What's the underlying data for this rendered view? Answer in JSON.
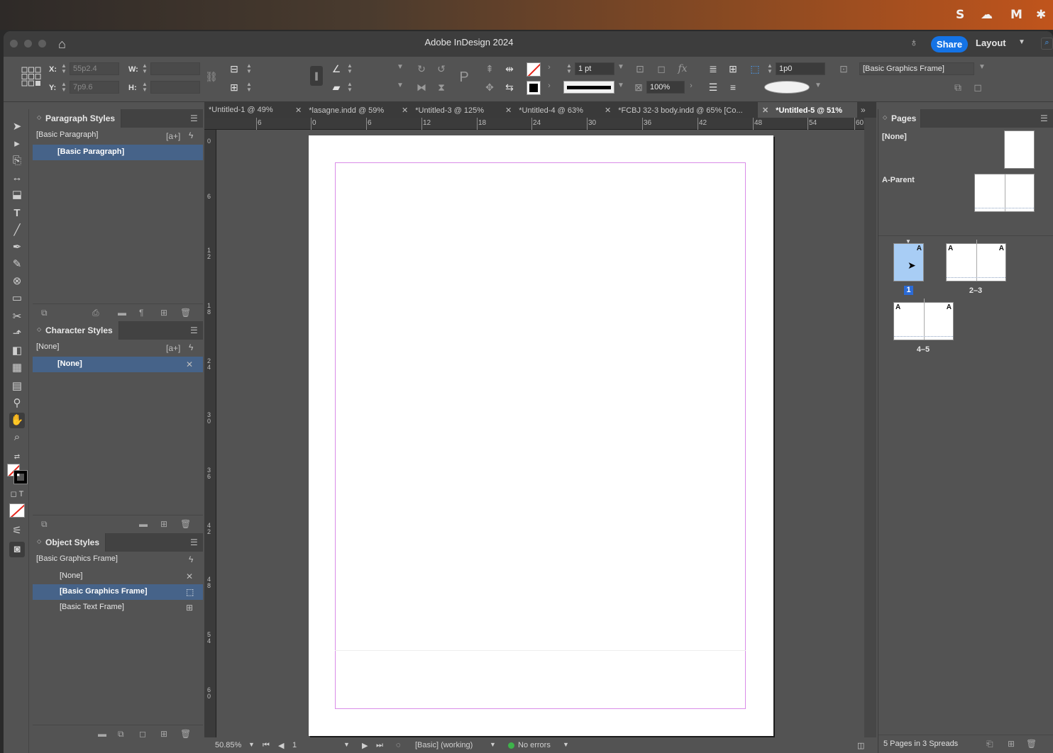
{
  "menubar": {
    "tray": [
      "S",
      "☁",
      "M",
      "✱"
    ]
  },
  "window": {
    "title": "Adobe InDesign 2024",
    "share_label": "Share",
    "workspace_label": "Layout"
  },
  "control_panel": {
    "x_label": "X:",
    "x_value": "55p2.4",
    "y_label": "Y:",
    "y_value": "7p9.6",
    "w_label": "W:",
    "h_label": "H:",
    "stroke_weight": "1 pt",
    "opacity": "100%",
    "gap": "1p0",
    "object_style": "[Basic Graphics Frame]"
  },
  "paragraph_styles": {
    "title": "Paragraph Styles",
    "current": "[Basic Paragraph]",
    "items": [
      "[Basic Paragraph]"
    ]
  },
  "character_styles": {
    "title": "Character Styles",
    "current": "[None]",
    "items": [
      "[None]"
    ]
  },
  "object_styles": {
    "title": "Object Styles",
    "current": "[Basic Graphics Frame]",
    "items": [
      "[None]",
      "[Basic Graphics Frame]",
      "[Basic Text Frame]"
    ]
  },
  "doc_tabs": [
    "*Untitled-1 @ 49%",
    "*lasagne.indd @ 59%",
    "*Untitled-3 @ 125%",
    "*Untitled-4 @ 63%",
    "*FCBJ 32-3 body.indd @ 65% [Co...",
    "*Untitled-5 @ 51%"
  ],
  "ruler_h": [
    "6",
    "0",
    "6",
    "12",
    "18",
    "24",
    "30",
    "36",
    "42",
    "48",
    "54",
    "60"
  ],
  "ruler_v": [
    "0",
    "6",
    "1\n2",
    "1\n8",
    "2\n4",
    "3\n0",
    "3\n6",
    "4\n2",
    "4\n8",
    "5\n4",
    "6\n0"
  ],
  "status": {
    "zoom": "50.85%",
    "page": "1",
    "preflight_profile": "[Basic] (working)",
    "errors": "No errors"
  },
  "pages_panel": {
    "title": "Pages",
    "parent_none": "[None]",
    "parent_a": "A-Parent",
    "page_letter": "A",
    "page_labels": [
      "1",
      "2–3",
      "4–5"
    ],
    "footer": "5 Pages in 3 Spreads"
  }
}
